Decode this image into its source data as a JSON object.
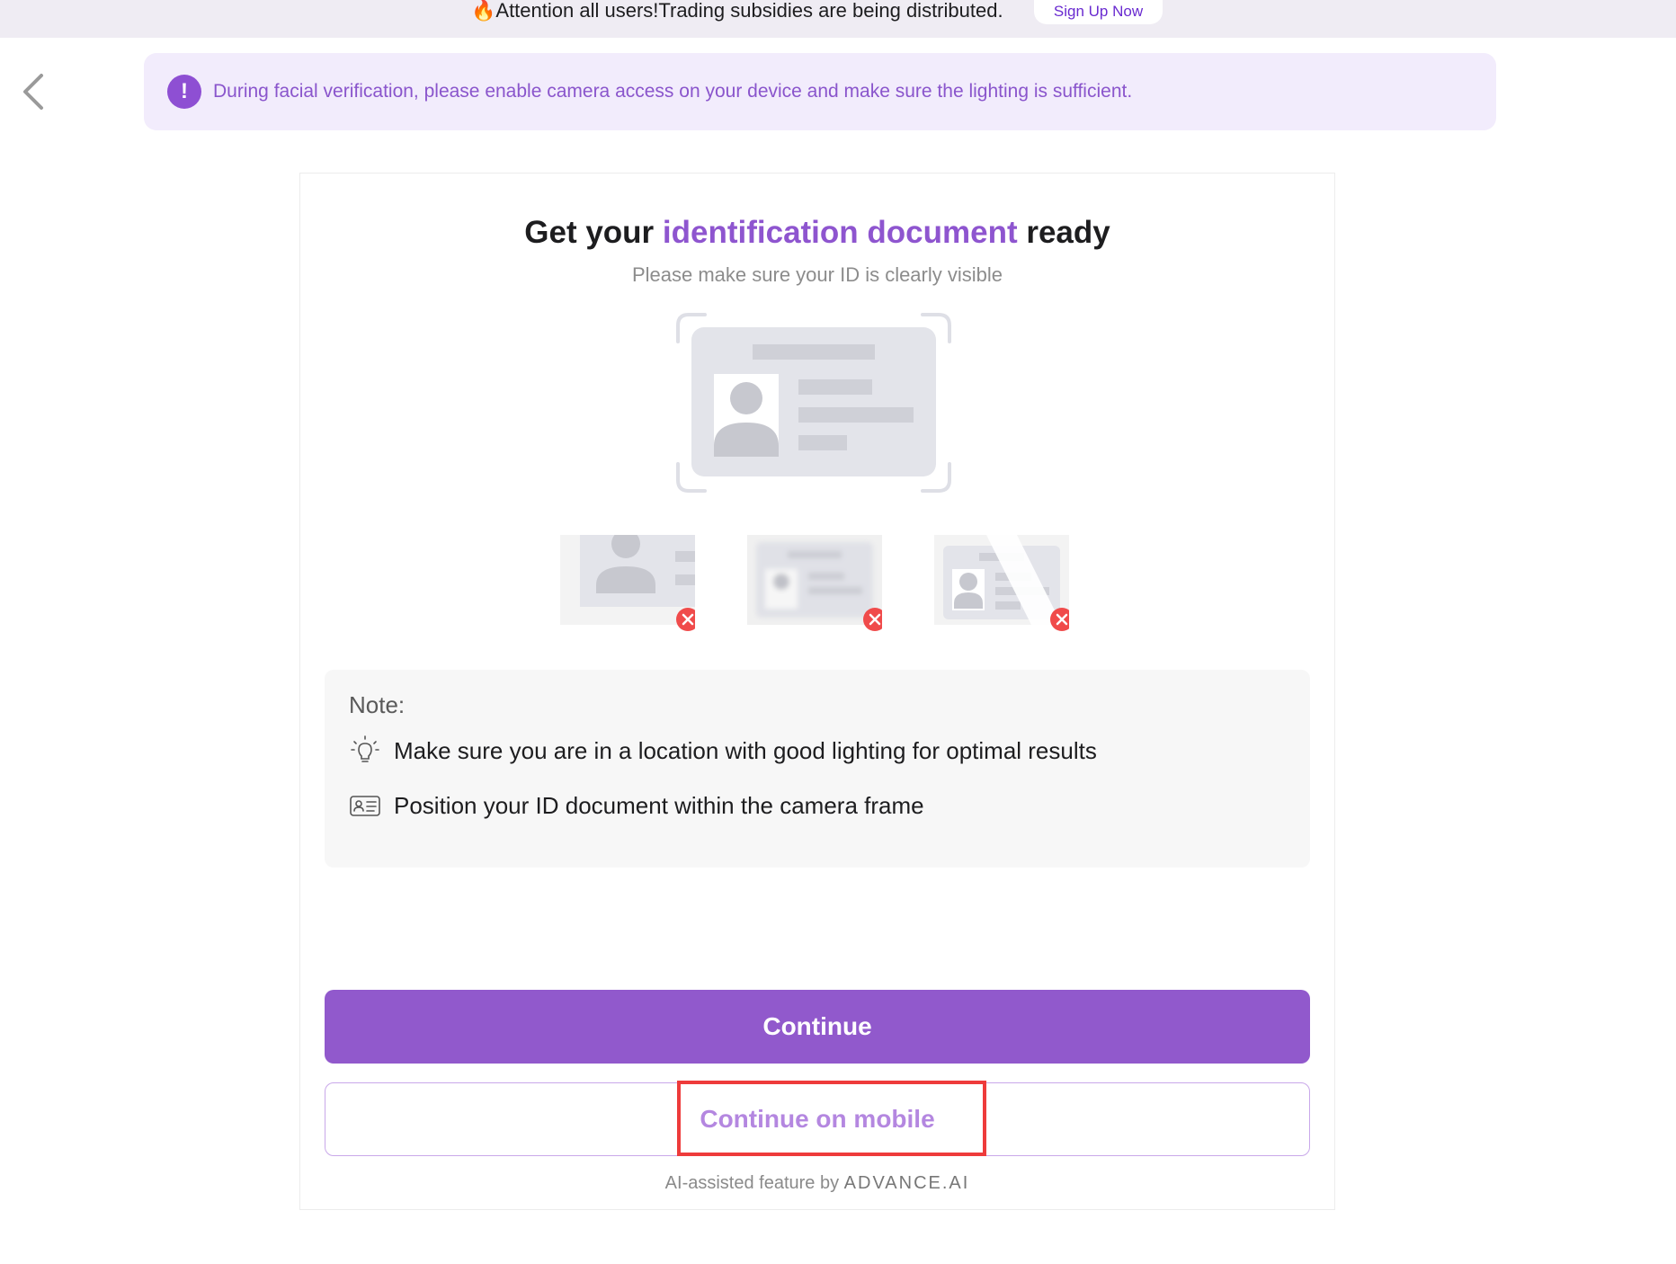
{
  "topbar": {
    "announcement": "🔥Attention all users!Trading subsidies are being distributed.",
    "signup_label": "Sign Up Now"
  },
  "banner": {
    "icon": "exclamation-icon",
    "text": "During facial verification, please enable camera access on your device and make sure the lighting is sufficient."
  },
  "card": {
    "title_prefix": "Get your ",
    "title_accent": "identification document",
    "title_suffix": " ready",
    "subtitle": "Please make sure your ID is clearly visible",
    "note": {
      "title": "Note:",
      "items": [
        {
          "icon": "lightbulb-icon",
          "text": "Make sure you are in a location with good lighting for optimal results"
        },
        {
          "icon": "id-card-icon",
          "text": "Position your ID document within the camera frame"
        }
      ]
    },
    "continue_label": "Continue",
    "continue_mobile_label": "Continue on mobile",
    "footer_prefix": "AI-assisted feature by ",
    "footer_brand": "ADVANCE.AI"
  },
  "colors": {
    "accent": "#8e55cf",
    "primary_button": "#9159cc",
    "banner_bg": "#f2ecfc",
    "error": "#f04b4b"
  }
}
